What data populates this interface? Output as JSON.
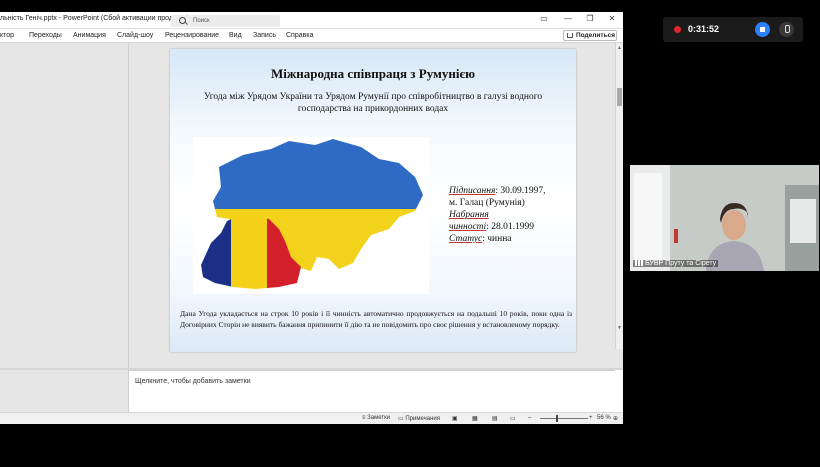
{
  "window": {
    "title": "льність Геніч.pptx - PowerPoint (Сбой активации продукта)",
    "search_placeholder": "Поиск",
    "controls": {
      "ribbon": "▭",
      "minimize": "—",
      "restore": "❐",
      "close": "✕"
    }
  },
  "menu": {
    "items": [
      "ктор",
      "Переходы",
      "Анимация",
      "Слайд-шоу",
      "Рецензирование",
      "Вид",
      "Запись",
      "Справка"
    ],
    "share_label": "Поделиться"
  },
  "slide": {
    "title": "Міжнародна співпраця з Румунією",
    "subtitle_line1": "Угода між Урядом України та Урядом Румунії про співробітництво в галузі водного",
    "subtitle_line2": "господарства на прикордонних водах",
    "signed_label": "Підписання",
    "signed_value": ": 30.09.1997,",
    "place": "м. Галац (Румунія)",
    "effective_label_1": "Набрання",
    "effective_label_2": "чинності",
    "effective_value": ": 28.01.1999",
    "status_label": "Статус",
    "status_value": ": чинна",
    "body": "Дана Угода укладається на строк 10 років і її чинність автоматично продовжується на подальші 10 років, поки одна із Договірних Сторін не виявить бажання припинити її дію та не повідомить про своє рішення у встановленому порядку.",
    "map_colors": {
      "ukraine_blue": "#2f6bc4",
      "ukraine_yellow": "#f3d21c",
      "ro_blue": "#1c2f86",
      "ro_yellow": "#f5d018",
      "ro_red": "#d4202a"
    }
  },
  "notes": {
    "placeholder": "Щелкните, чтобы добавить заметки"
  },
  "status": {
    "notes_btn": "Заметки",
    "comments_btn": "Примечания",
    "zoom": "56 %"
  },
  "meeting": {
    "timer": "0:31:52"
  },
  "camera": {
    "label": "БУВР Пруту та Сірету"
  }
}
